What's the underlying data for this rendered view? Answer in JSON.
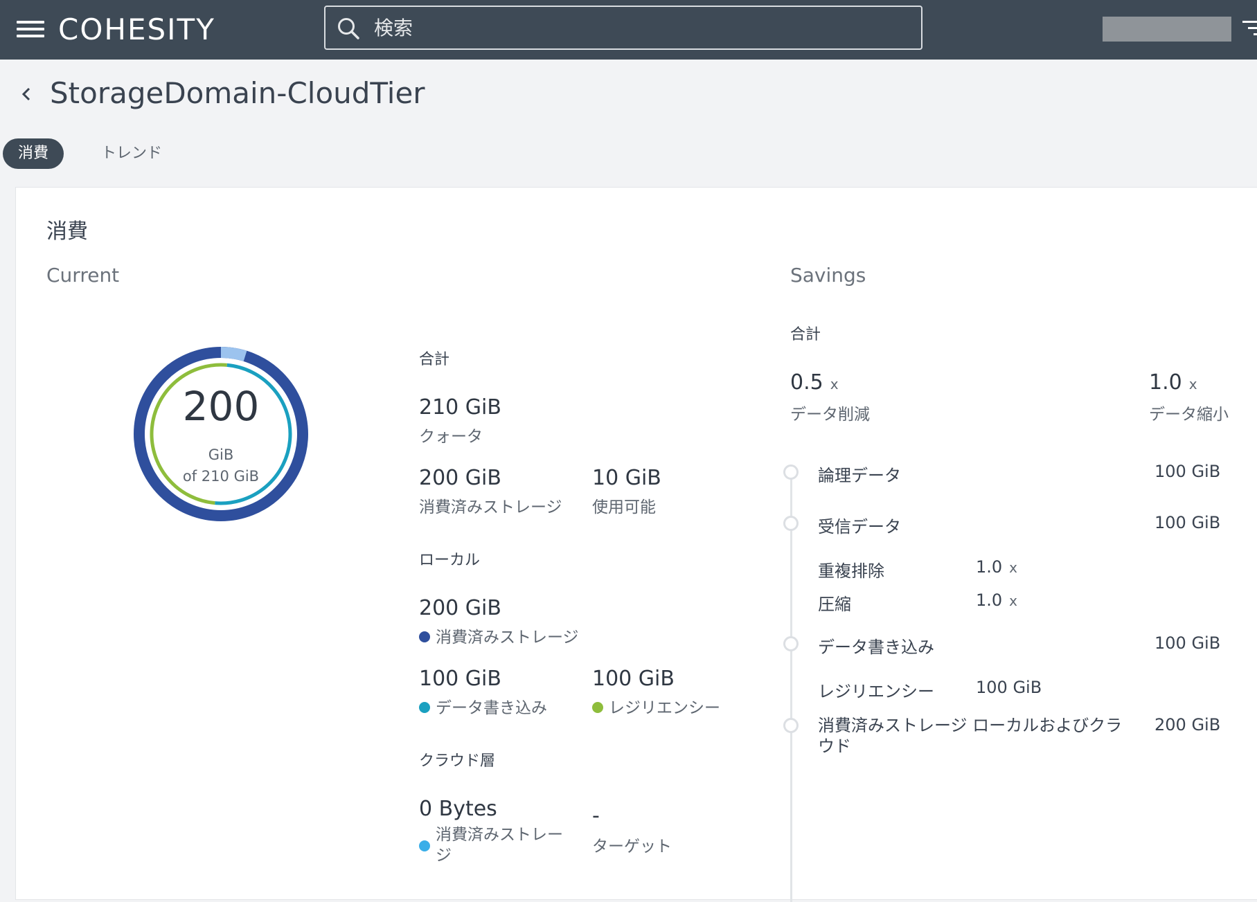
{
  "header": {
    "logo": "COHESITY",
    "search_placeholder": "検索",
    "icons": [
      "menu-icon",
      "search-icon",
      "filter-icon"
    ]
  },
  "page": {
    "title": "StorageDomain-CloudTier",
    "tabs": [
      {
        "label": "消費",
        "active": true
      },
      {
        "label": "トレンド",
        "active": false
      }
    ]
  },
  "card": {
    "title": "消費",
    "current": {
      "label": "Current",
      "donut": {
        "value": "200",
        "unit": "GiB",
        "of": "of 210 GiB",
        "used_fraction": 0.952,
        "colors": {
          "outer": "#2f4f9d",
          "inner_green": "#8ebd3c",
          "inner_teal": "#1aa0c0",
          "light": "#9cc3ee"
        }
      },
      "total": {
        "label": "合計",
        "quota_value": "210 GiB",
        "quota_label": "クォータ",
        "consumed_value": "200 GiB",
        "consumed_label": "消費済みストレージ",
        "available_value": "10 GiB",
        "available_label": "使用可能"
      },
      "local": {
        "label": "ローカル",
        "consumed_value": "200 GiB",
        "consumed_label": "消費済みストレージ",
        "write_value": "100 GiB",
        "write_label": "データ書き込み",
        "resiliency_value": "100 GiB",
        "resiliency_label": "レジリエンシー",
        "colors": {
          "consumed": "#2f4f9d",
          "write": "#1aa0c0",
          "resiliency": "#8ebd3c"
        }
      },
      "cloud": {
        "label": "クラウド層",
        "consumed_value": "0 Bytes",
        "consumed_label_1": "消費済みストレー",
        "consumed_label_2": "ジ",
        "target_value": "-",
        "target_label": "ターゲット",
        "color": "#3aaee8"
      }
    },
    "savings": {
      "label": "Savings",
      "total_label": "合計",
      "reduction_value": "0.5",
      "reduction_label": "データ削減",
      "shrink_value": "1.0",
      "shrink_label": "データ縮小",
      "mult": "x",
      "timeline": {
        "logical_label": "論理データ",
        "logical_value": "100 GiB",
        "received_label": "受信データ",
        "received_value": "100 GiB",
        "dedupe_label": "重複排除",
        "dedupe_value": "1.0",
        "compress_label": "圧縮",
        "compress_value": "1.0",
        "write_label": "データ書き込み",
        "write_value": "100 GiB",
        "resiliency_label": "レジリエンシー",
        "resiliency_value": "100 GiB",
        "consumed_label_1": "消費済みストレージ ローカルおよびクラ",
        "consumed_label_2": "ウド",
        "consumed_value": "200 GiB"
      }
    }
  }
}
